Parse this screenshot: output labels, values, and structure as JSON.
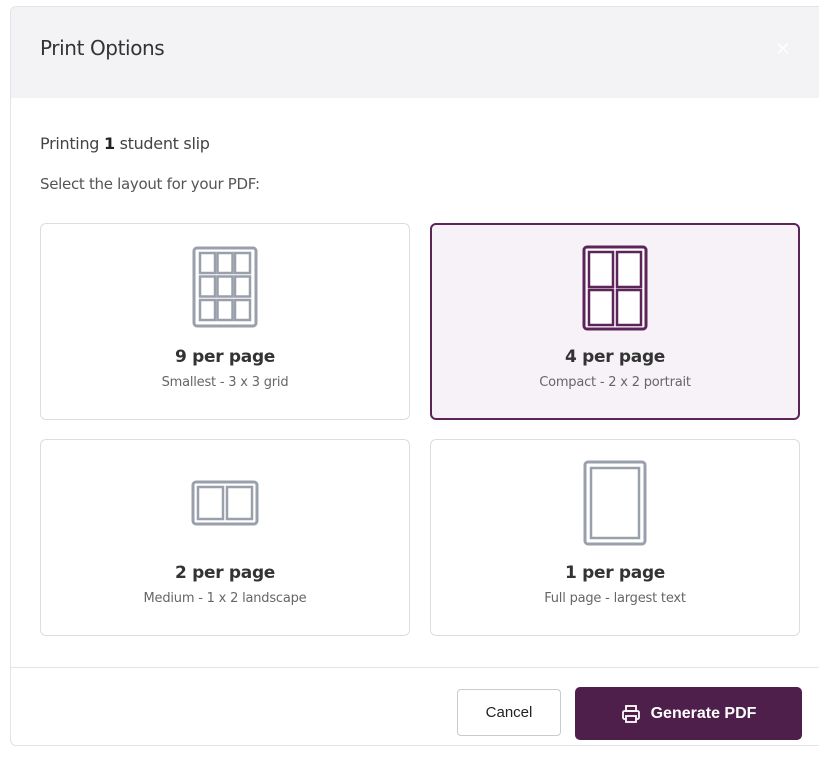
{
  "dialog": {
    "title": "Print Options",
    "close_icon": "close-icon",
    "printing_prefix": "Printing ",
    "printing_count": "1",
    "printing_suffix": " student slip",
    "instruction": "Select the layout for your PDF:"
  },
  "options": [
    {
      "icon": "grid-3x3-icon",
      "title": "9 per page",
      "description": "Smallest - 3 x 3 grid",
      "selected": false
    },
    {
      "icon": "grid-2x2-icon",
      "title": "4 per page",
      "description": "Compact - 2 x 2 portrait",
      "selected": true
    },
    {
      "icon": "grid-1x2-icon",
      "title": "2 per page",
      "description": "Medium - 1 x 2 landscape",
      "selected": false
    },
    {
      "icon": "single-page-icon",
      "title": "1 per page",
      "description": "Full page - largest text",
      "selected": false
    }
  ],
  "footer": {
    "cancel_label": "Cancel",
    "generate_label": "Generate PDF",
    "generate_icon": "printer-icon"
  },
  "colors": {
    "accent": "#4f1f4c",
    "selected_border": "#5c2458",
    "selected_bg": "#f7f2f7",
    "icon_gray": "#9aa0ab"
  }
}
